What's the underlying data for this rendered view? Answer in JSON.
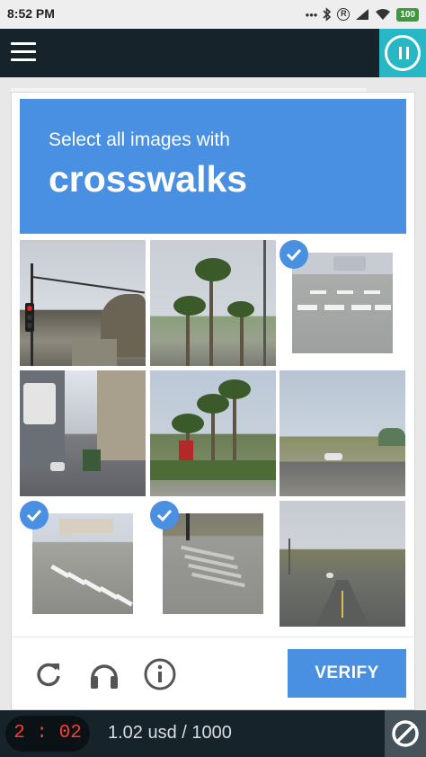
{
  "status_bar": {
    "time": "8:52 PM",
    "battery": "100",
    "icons": [
      "dots-icon",
      "bluetooth-icon",
      "registered-icon",
      "signal-icon",
      "wifi-icon",
      "battery-icon"
    ]
  },
  "app_bar": {
    "icons": [
      "hamburger-menu-icon",
      "pause-icon"
    ],
    "accent_color": "#27b7c5",
    "background_color": "#16232b"
  },
  "captcha": {
    "prompt": "Select all images with",
    "target": "crosswalks",
    "header_color": "#4a90e2",
    "tiles": [
      {
        "scene": "traffic-light-street",
        "selected": false
      },
      {
        "scene": "palm-tree-boulevard",
        "selected": false
      },
      {
        "scene": "crosswalk-parking-lot",
        "selected": true
      },
      {
        "scene": "city-street-tram",
        "selected": false
      },
      {
        "scene": "palm-trees-store",
        "selected": false
      },
      {
        "scene": "field-highway",
        "selected": false
      },
      {
        "scene": "crosswalk-intersection",
        "selected": true
      },
      {
        "scene": "crosswalk-corner",
        "selected": true
      },
      {
        "scene": "open-road",
        "selected": false
      }
    ],
    "footer_icons": [
      "reload-icon",
      "headphones-icon",
      "info-icon"
    ],
    "verify_label": "VERIFY"
  },
  "bottom_bar": {
    "timer": "2 : 02",
    "earnings": "1.02 usd / 1000",
    "icons": [
      "block-icon"
    ]
  }
}
